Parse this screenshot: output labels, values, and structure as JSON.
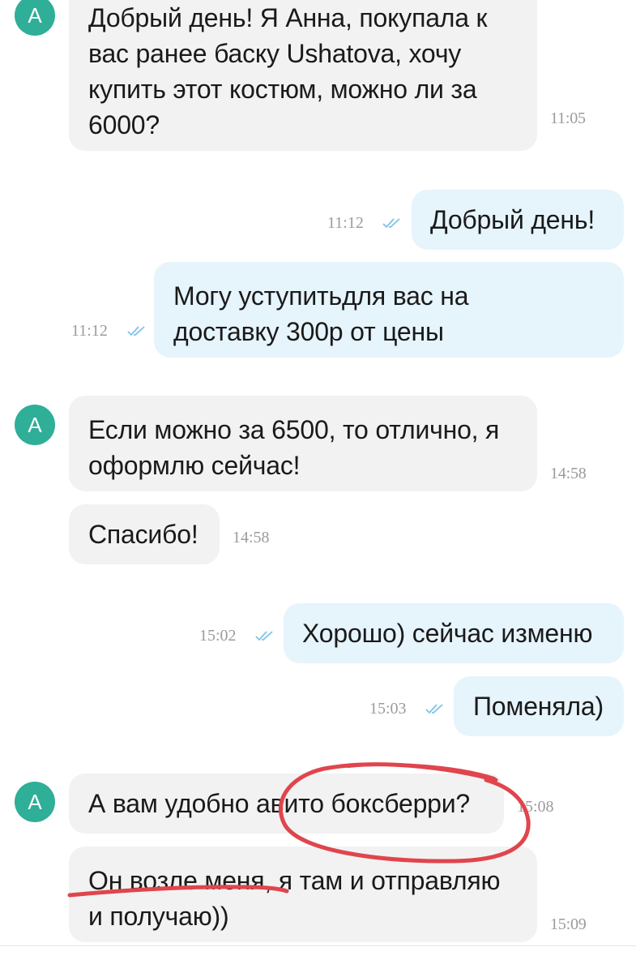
{
  "contact": {
    "avatar_letter": "A"
  },
  "messages": [
    {
      "direction": "incoming",
      "text": "Добрый день! Я Анна, покупала к\nвас ранее баску Ushatova, хочу\nкупить этот костюм, можно ли за\n6000?",
      "time": "11:05"
    },
    {
      "direction": "outgoing",
      "text": "Добрый день!",
      "time": "11:12",
      "status": "read"
    },
    {
      "direction": "outgoing",
      "text": "Могу уступитьдля вас  на\nдоставку 300р от цены",
      "time": "11:12",
      "status": "read"
    },
    {
      "direction": "incoming",
      "text": "Если можно за 6500, то отлично, я\nоформлю сейчас!",
      "time": "14:58"
    },
    {
      "direction": "incoming",
      "text": "Спасибо!",
      "time": "14:58"
    },
    {
      "direction": "outgoing",
      "text": "Хорошо) сейчас изменю",
      "time": "15:02",
      "status": "read"
    },
    {
      "direction": "outgoing",
      "text": "Поменяла)",
      "time": "15:03",
      "status": "read"
    },
    {
      "direction": "incoming",
      "text": "А вам удобно авито боксберри?",
      "time": "15:08"
    },
    {
      "direction": "incoming",
      "text": "Он возле меня, я там и отправляю\nи получаю))",
      "time": "15:09"
    }
  ],
  "colors": {
    "avatar": "#2fae98",
    "incoming_bubble": "#f2f2f2",
    "outgoing_bubble": "#e6f4fc",
    "timestamp": "#9b9b9b",
    "read_ticks": "#7ec3e6",
    "annotation": "#e0454d"
  },
  "icons": {
    "read_status": "double-check-icon"
  }
}
